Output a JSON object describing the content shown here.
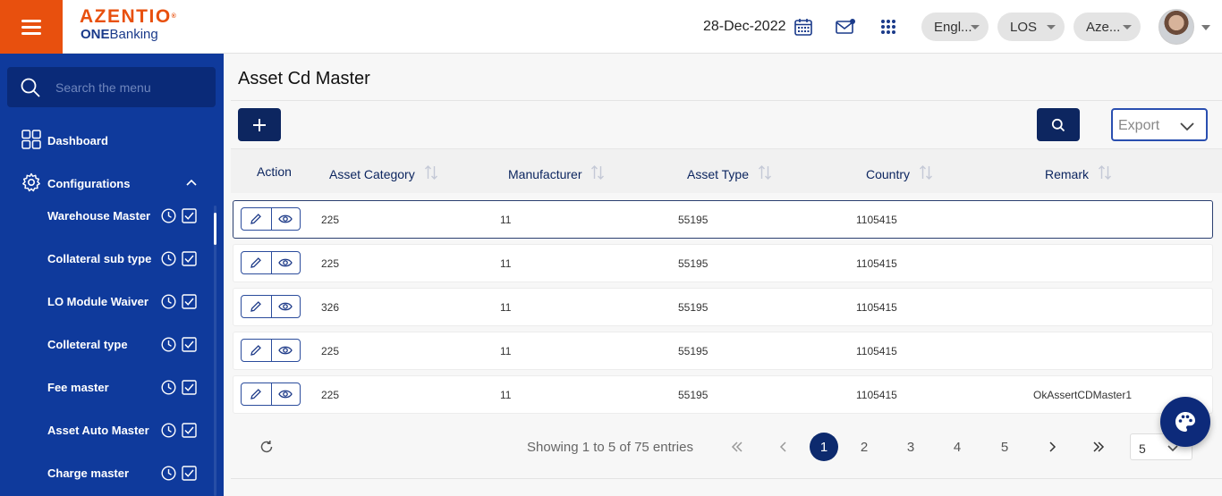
{
  "header": {
    "brand": "AZENTIO",
    "brand_mark": "®",
    "product_bold": "ONE",
    "product_rest": "Banking",
    "date": "28-Dec-2022",
    "language": "Engl...",
    "module": "LOS",
    "entity": "Aze...",
    "accent_color": "#e8500e",
    "icons": [
      "menu-icon",
      "calendar-icon",
      "mail-icon",
      "apps-grid-icon",
      "user-avatar",
      "chevron-down-icon"
    ]
  },
  "sidebar": {
    "search_placeholder": "Search the menu",
    "dashboard": "Dashboard",
    "configurations": "Configurations",
    "items": [
      {
        "label": "Warehouse Master"
      },
      {
        "label": "Collateral sub type"
      },
      {
        "label": "LO Module Waiver"
      },
      {
        "label": "Colleteral type"
      },
      {
        "label": "Fee master"
      },
      {
        "label": "Asset Auto Master"
      },
      {
        "label": "Charge master"
      }
    ],
    "background_color": "#0f3a9c"
  },
  "main": {
    "title": "Asset Cd Master",
    "export_label": "Export",
    "columns": [
      "Action",
      "Asset Category",
      "Manufacturer",
      "Asset Type",
      "Country",
      "Remark"
    ],
    "rows": [
      {
        "asset_category": "225",
        "manufacturer": "11",
        "asset_type": "55195",
        "country": "1105415",
        "remark": ""
      },
      {
        "asset_category": "225",
        "manufacturer": "11",
        "asset_type": "55195",
        "country": "1105415",
        "remark": ""
      },
      {
        "asset_category": "326",
        "manufacturer": "11",
        "asset_type": "55195",
        "country": "1105415",
        "remark": ""
      },
      {
        "asset_category": "225",
        "manufacturer": "11",
        "asset_type": "55195",
        "country": "1105415",
        "remark": ""
      },
      {
        "asset_category": "225",
        "manufacturer": "11",
        "asset_type": "55195",
        "country": "1105415",
        "remark": "OkAssertCDMaster1"
      }
    ],
    "pagination": {
      "showing": "Showing 1 to 5 of 75 entries",
      "pages": [
        "1",
        "2",
        "3",
        "4",
        "5"
      ],
      "current_page": "1",
      "first": "«",
      "prev": "‹",
      "next": "›",
      "last": "»",
      "page_size": "5"
    },
    "primary_button_color": "#0d2660"
  }
}
